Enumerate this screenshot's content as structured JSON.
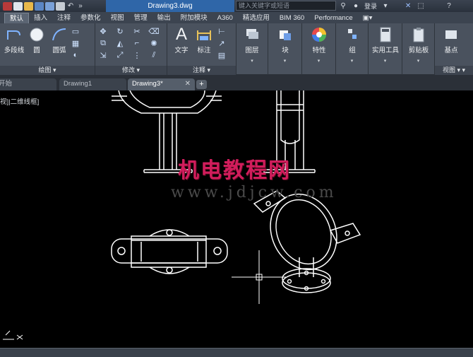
{
  "app": {
    "document_title": "Drawing3.dwg",
    "search_placeholder": "键入关键字或短语",
    "signin_label": "登录"
  },
  "ribbon_tabs": [
    "默认",
    "插入",
    "注释",
    "参数化",
    "视图",
    "管理",
    "输出",
    "附加模块",
    "A360",
    "精选应用",
    "BIM 360",
    "Performance"
  ],
  "active_tab": "默认",
  "panels": {
    "draw": {
      "title": "绘图",
      "polyline_label": "多段线",
      "circle_label": "圆",
      "arc_label": "圆弧"
    },
    "modify": {
      "title": "修改"
    },
    "annotation": {
      "title": "注释",
      "text_label": "文字",
      "dimension_label": "标注"
    },
    "layers": {
      "label": "图层"
    },
    "block": {
      "label": "块"
    },
    "properties": {
      "label": "特性"
    },
    "groups": {
      "label": "组"
    },
    "utilities": {
      "label": "实用工具"
    },
    "clipboard": {
      "label": "剪贴板"
    },
    "view": {
      "title": "视图",
      "base_label": "基点"
    }
  },
  "file_tabs": [
    {
      "label": "开始",
      "closable": false
    },
    {
      "label": "Drawing1",
      "closable": false
    },
    {
      "label": "Drawing3*",
      "closable": true
    }
  ],
  "viewport_label": "视]|二维线框]",
  "watermark": {
    "title": "机电教程网",
    "url": "www.jdjcw.com"
  },
  "colors": {
    "accent": "#2f66a8",
    "ribbon_bg": "#4a525e",
    "canvas_bg": "#000000",
    "watermark_red": "#d11d5c"
  }
}
